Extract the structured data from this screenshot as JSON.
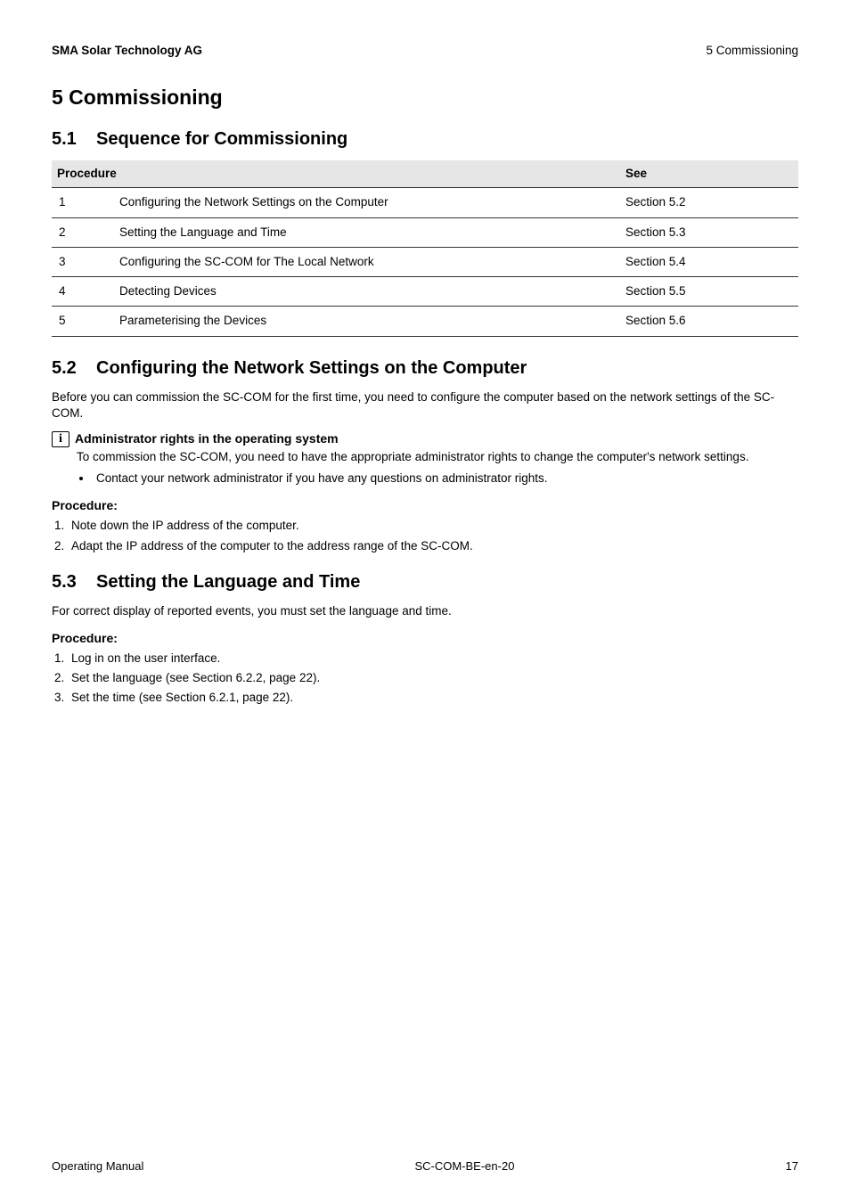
{
  "header": {
    "left": "SMA Solar Technology AG",
    "right": "5  Commissioning"
  },
  "chapter": {
    "num": "5",
    "title": "Commissioning",
    "full": "5  Commissioning"
  },
  "sec51": {
    "num": "5.1",
    "title": "Sequence for Commissioning",
    "table": {
      "col1": "Procedure",
      "col2": "See",
      "rows": [
        {
          "n": "1",
          "desc": "Configuring the Network Settings on the Computer",
          "see": "Section 5.2"
        },
        {
          "n": "2",
          "desc": "Setting the Language and Time",
          "see": "Section 5.3"
        },
        {
          "n": "3",
          "desc": "Configuring the SC-COM for The Local Network",
          "see": "Section 5.4"
        },
        {
          "n": "4",
          "desc": "Detecting Devices",
          "see": "Section 5.5"
        },
        {
          "n": "5",
          "desc": "Parameterising the Devices",
          "see": "Section 5.6"
        }
      ]
    }
  },
  "sec52": {
    "num": "5.2",
    "title": "Configuring the Network Settings on the Computer",
    "intro": "Before you can commission the SC-COM for the first time, you need to configure the computer based on the network settings of the SC-COM.",
    "info": {
      "icon_glyph": "i",
      "title": "Administrator rights in the operating system",
      "body": "To commission the SC-COM, you need to have the appropriate administrator rights to change the computer's network settings.",
      "bullet": "Contact your network administrator if you have any questions on administrator rights."
    },
    "procedure_label": "Procedure:",
    "steps": [
      "Note down the IP address of the computer.",
      "Adapt the IP address of the computer to the address range of the SC-COM."
    ]
  },
  "sec53": {
    "num": "5.3",
    "title": "Setting the Language and Time",
    "intro": "For correct display of reported events, you must set the language and time.",
    "procedure_label": "Procedure:",
    "steps": [
      "Log in on the user interface.",
      "Set the language (see Section 6.2.2, page 22).",
      "Set the time (see Section 6.2.1, page 22)."
    ]
  },
  "footer": {
    "left": "Operating Manual",
    "center": "SC-COM-BE-en-20",
    "right": "17"
  }
}
